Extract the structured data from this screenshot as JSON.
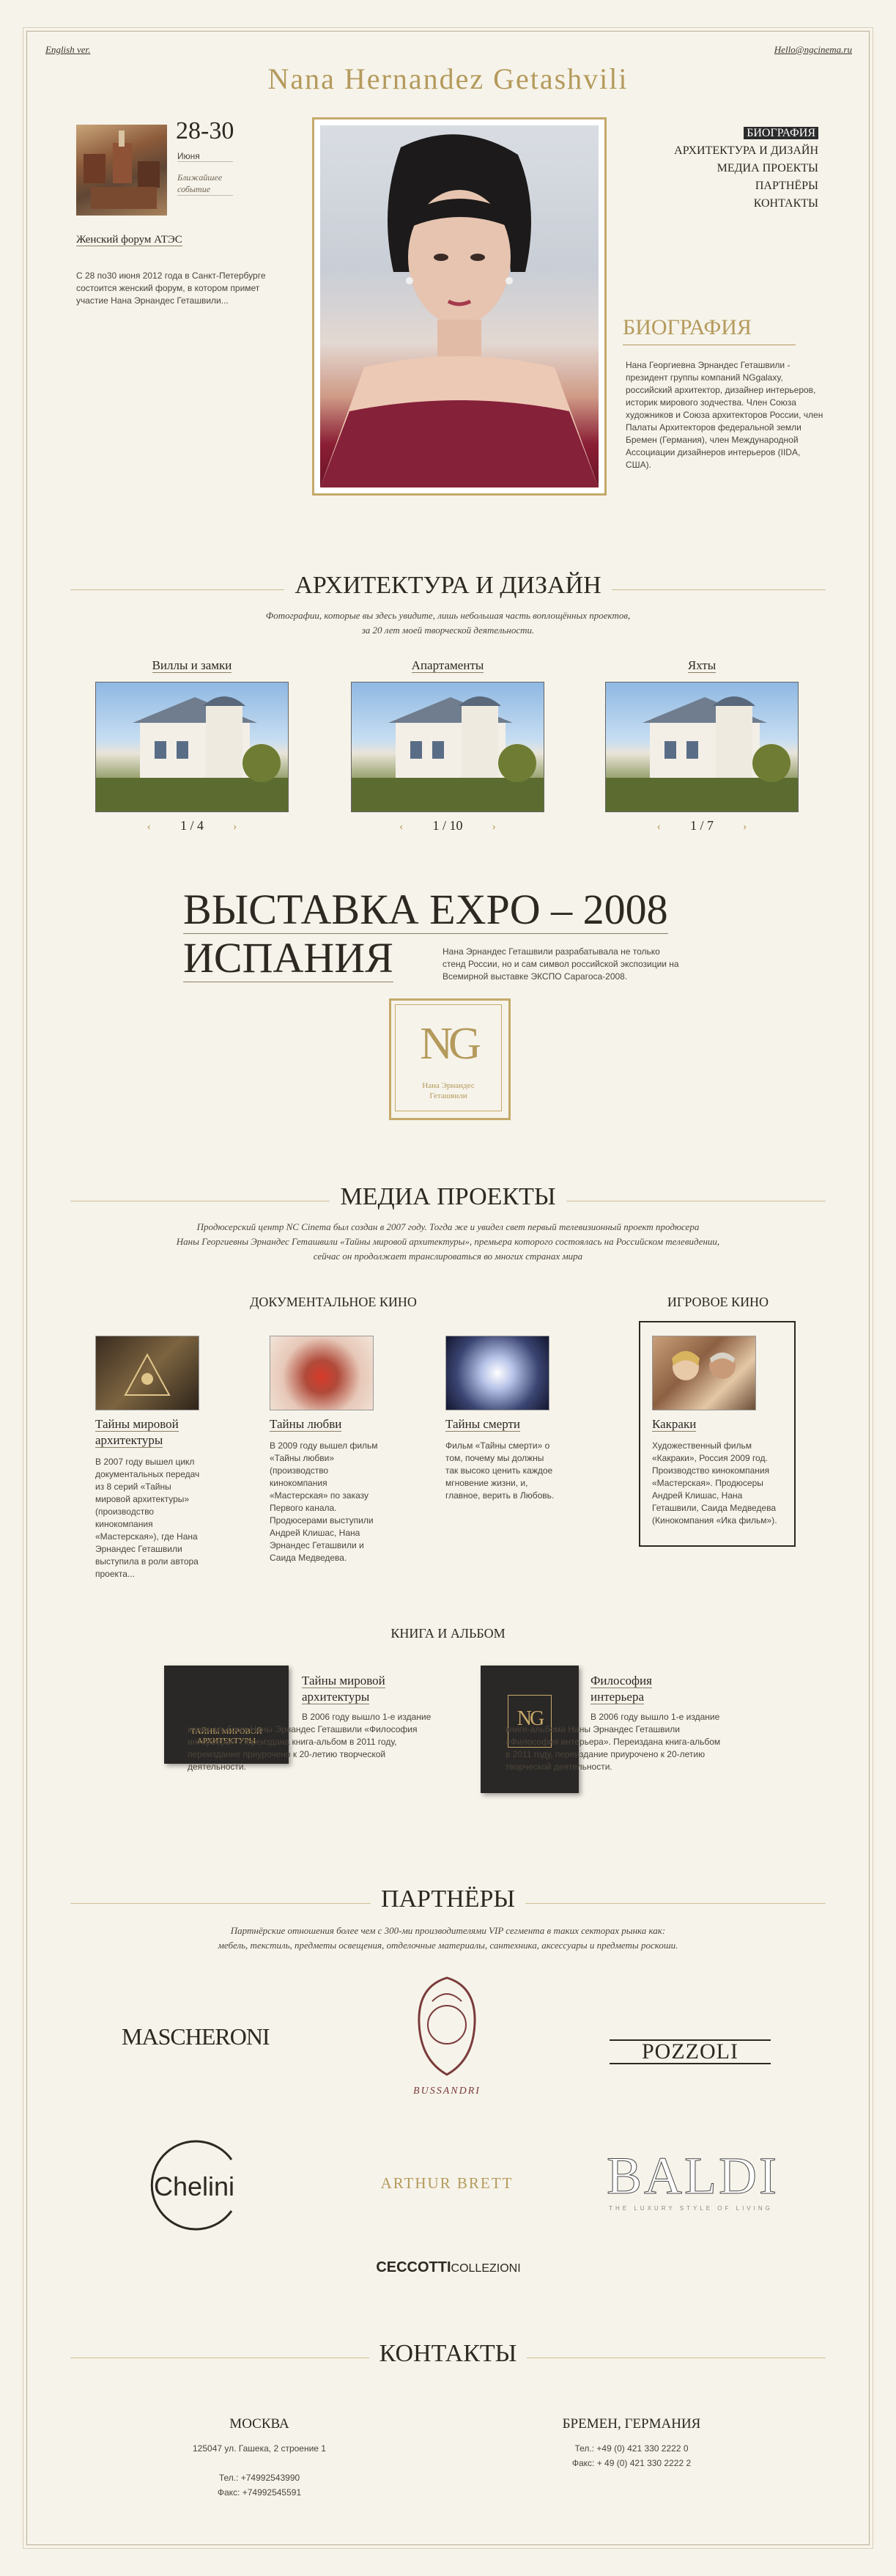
{
  "header": {
    "lang_link": "English ver.",
    "email_link": "Hello@ngcinema.ru",
    "name": "Nana Hernandez Getashvili"
  },
  "event": {
    "date": "28-30",
    "month": "Июня",
    "soon": "Ближайшее событие",
    "title": "Женский форум АТЭС",
    "text": "С 28 по30 июня 2012 года в Санкт-Петербурге состоится женский форум, в котором примет участие Нана Эрнандес Геташвили..."
  },
  "nav": {
    "items": [
      "БИОГРАФИЯ",
      "АРХИТЕКТУРА И ДИЗАЙН",
      "МЕДИА ПРОЕКТЫ",
      "ПАРТНЁРЫ",
      "КОНТАКТЫ"
    ]
  },
  "bio": {
    "title": "БИОГРАФИЯ",
    "text": "Нана Георгиевна Эрнандес Геташвили - президент группы компаний NGgalaxy, российский архитектор, дизайнер интерьеров, историк мирового зодчества. Член Союза художников и Союза архитекторов России, член Палаты Архитекторов федеральной земли Бремен (Германия), член Международной Ассоциации дизайнеров интерьеров (IIDA, США)."
  },
  "architecture": {
    "title": "АРХИТЕКТУРА И ДИЗАЙН",
    "subtitle_1": "Фотографии, которые вы здесь увидите, лишь небольшая часть воплощённых проектов,",
    "subtitle_2": "за 20 лет моей творческой деятельности.",
    "categories": [
      {
        "label": "Виллы и замки",
        "pager": "1 / 4"
      },
      {
        "label": "Апартаменты",
        "pager": "1 / 10"
      },
      {
        "label": "Яхты",
        "pager": "1 / 7"
      }
    ],
    "arrow_left": "‹",
    "arrow_right": "›"
  },
  "expo": {
    "line1": "ВЫСТАВКА EXPO – 2008",
    "line2": "ИСПАНИЯ",
    "text": "Нана Эрнандес Геташвили разрабатывала не только стенд России, но и сам символ российской экспозиции на Всемирной выставке ЭКСПО Сарагоса-2008.",
    "logo_letters": "NG",
    "logo_line1": "Нана Эрнандес",
    "logo_line2": "Геташвили"
  },
  "media": {
    "title": "МЕДИА ПРОЕКТЫ",
    "subtitle_1": "Продюсерский центр NC Cinema был создан в 2007 году. Тогда же и увидел свет первый телевизионный проект продюсера",
    "subtitle_2": "Наны Георгиевны Эрнандес Геташвили «Тайны мировой архитектуры», премьера которого состоялась на Российском телевидении,",
    "subtitle_3": "сейчас он продолжает транслироваться во многих странах мира",
    "doc_title": "ДОКУМЕНТАЛЬНОЕ КИНО",
    "feature_title": "ИГРОВОЕ КИНО",
    "items": [
      {
        "title_1": "Тайны мировой",
        "title_2": "архитектуры",
        "text": "В 2007 году вышел цикл документальных передач из 8 серий «Тайны мировой архитектуры» (производство кинокомпания «Мастерская»), где Нана Эрнандес Геташвили выступила в роли автора проекта..."
      },
      {
        "title_1": "Тайны любви",
        "title_2": "",
        "text": "В 2009 году вышел фильм «Тайны любви» (производство кинокомпания «Мастерская» по заказу Первого канала. Продюсерами выступили Андрей Клишас, Нана Эрнандес Геташвили и Саида Медведева."
      },
      {
        "title_1": "Тайны смерти",
        "title_2": "",
        "text": "Фильм «Тайны смерти» о том, почему мы должны так высоко ценить каждое мгновение жизни, и, главное, верить в Любовь."
      },
      {
        "title_1": "Какраки",
        "title_2": "",
        "text": "Художественный фильм «Какраки», Россия 2009 год. Производство кинокомпания «Мастерская». Продюсеры Андрей Клишас, Нана Геташвили, Саида Медведева (Кинокомпания «Ика фильм»)."
      }
    ]
  },
  "books": {
    "title": "КНИГА И АЛЬБОМ",
    "items": [
      {
        "title_1": "Тайны мировой",
        "title_2": "архитектуры",
        "text": "В 2006 году вышло 1-е издание книги-альбома Наны Эрнандес Геташвили «Философия интерьера». Переиздана книга-альбом в 2011 году, переиздание приурочено к 20-летию творческой деятельности.",
        "cover": "ТАЙНЫ МИРОВОЙ АРХИТЕКТУРЫ"
      },
      {
        "title_1": "Философия",
        "title_2": "интерьера",
        "text": "В 2006 году вышло 1-е издание книги-альбома Наны Эрнандес Геташвили «Философия интерьера». Переиздана книга-альбом в 2011 году, переиздание приурочено к 20-летию творческой деятельности.",
        "cover": "NG"
      }
    ]
  },
  "partners": {
    "title": "ПАРТНЁРЫ",
    "subtitle_1": "Партнёрские отношения более чем с 300-ми производителями VIP сегмента в таких секторах рынка как:",
    "subtitle_2": "мебель, текстиль, предметы освещения, отделочные материалы, сантехника, аксессуары и предметы роскоши.",
    "logos": [
      "MASCHERONI",
      "BUSSANDRI",
      "POZZOLI",
      "Chelini",
      "ARTHUR BRETT",
      "BALDI",
      "CECCOTTI",
      "COLLEZIONI"
    ],
    "baldi_tag": "THE LUXURY STYLE OF LIVING"
  },
  "contacts": {
    "title": "КОНТАКТЫ",
    "moscow": {
      "city": "МОСКВА",
      "address": "125047 ул. Гашека, 2 строение 1",
      "phone": "Тел.: +74992543990",
      "fax": "Факс: +74992545591"
    },
    "bremen": {
      "city": "БРЕМЕН, ГЕРМАНИЯ",
      "phone": "Тел.: +49 (0) 421 330 2222 0",
      "fax": "Факс: + 49 (0) 421 330 2222 2"
    }
  }
}
